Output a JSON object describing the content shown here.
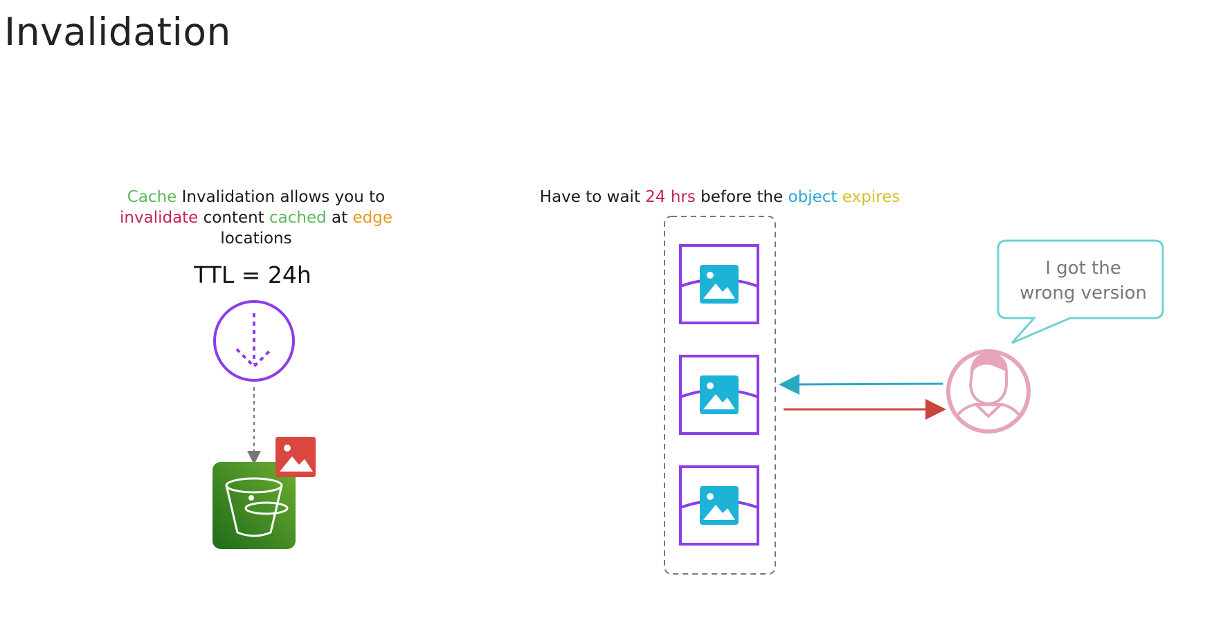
{
  "title": "Invalidation",
  "left_caption": {
    "parts": [
      {
        "text": "Cache",
        "color": "#5cb85c"
      },
      {
        "text": " Invalidation allows you to ",
        "color": "#1a1a1a"
      },
      {
        "text": "invalidate",
        "color": "#c7244f"
      },
      {
        "text": " content ",
        "color": "#1a1a1a"
      },
      {
        "text": "cached",
        "color": "#5cb85c"
      },
      {
        "text": " at ",
        "color": "#1a1a1a"
      },
      {
        "text": "edge",
        "color": "#e69a1c"
      },
      {
        "text": " locations",
        "color": "#1a1a1a"
      }
    ]
  },
  "ttl_label": "TTL = 24h",
  "right_caption": {
    "parts": [
      {
        "text": "Have to wait ",
        "color": "#1a1a1a"
      },
      {
        "text": "24 hrs",
        "color": "#c7244f"
      },
      {
        "text": " before the ",
        "color": "#1a1a1a"
      },
      {
        "text": "object",
        "color": "#2ba6d6"
      },
      {
        "text": " expires",
        "color": "#d4c12a"
      }
    ]
  },
  "speech_bubble": {
    "line1": "I got the",
    "line2": "wrong version"
  },
  "colors": {
    "purple": "#8c3ee8",
    "s3_green": "#3f8f28",
    "image_red": "#d9473f",
    "image_cyan": "#1db3d6",
    "arrow_cyan": "#2aa8c4",
    "arrow_red": "#c9453f",
    "user_pink": "#e6a5b8",
    "bubble_border": "#6fd0d6",
    "dashed_gray": "#777777"
  },
  "icons": [
    "cache-invalidation-icon",
    "s3-bucket-icon",
    "image-icon",
    "edge-cache-image-icon",
    "user-avatar-icon"
  ]
}
